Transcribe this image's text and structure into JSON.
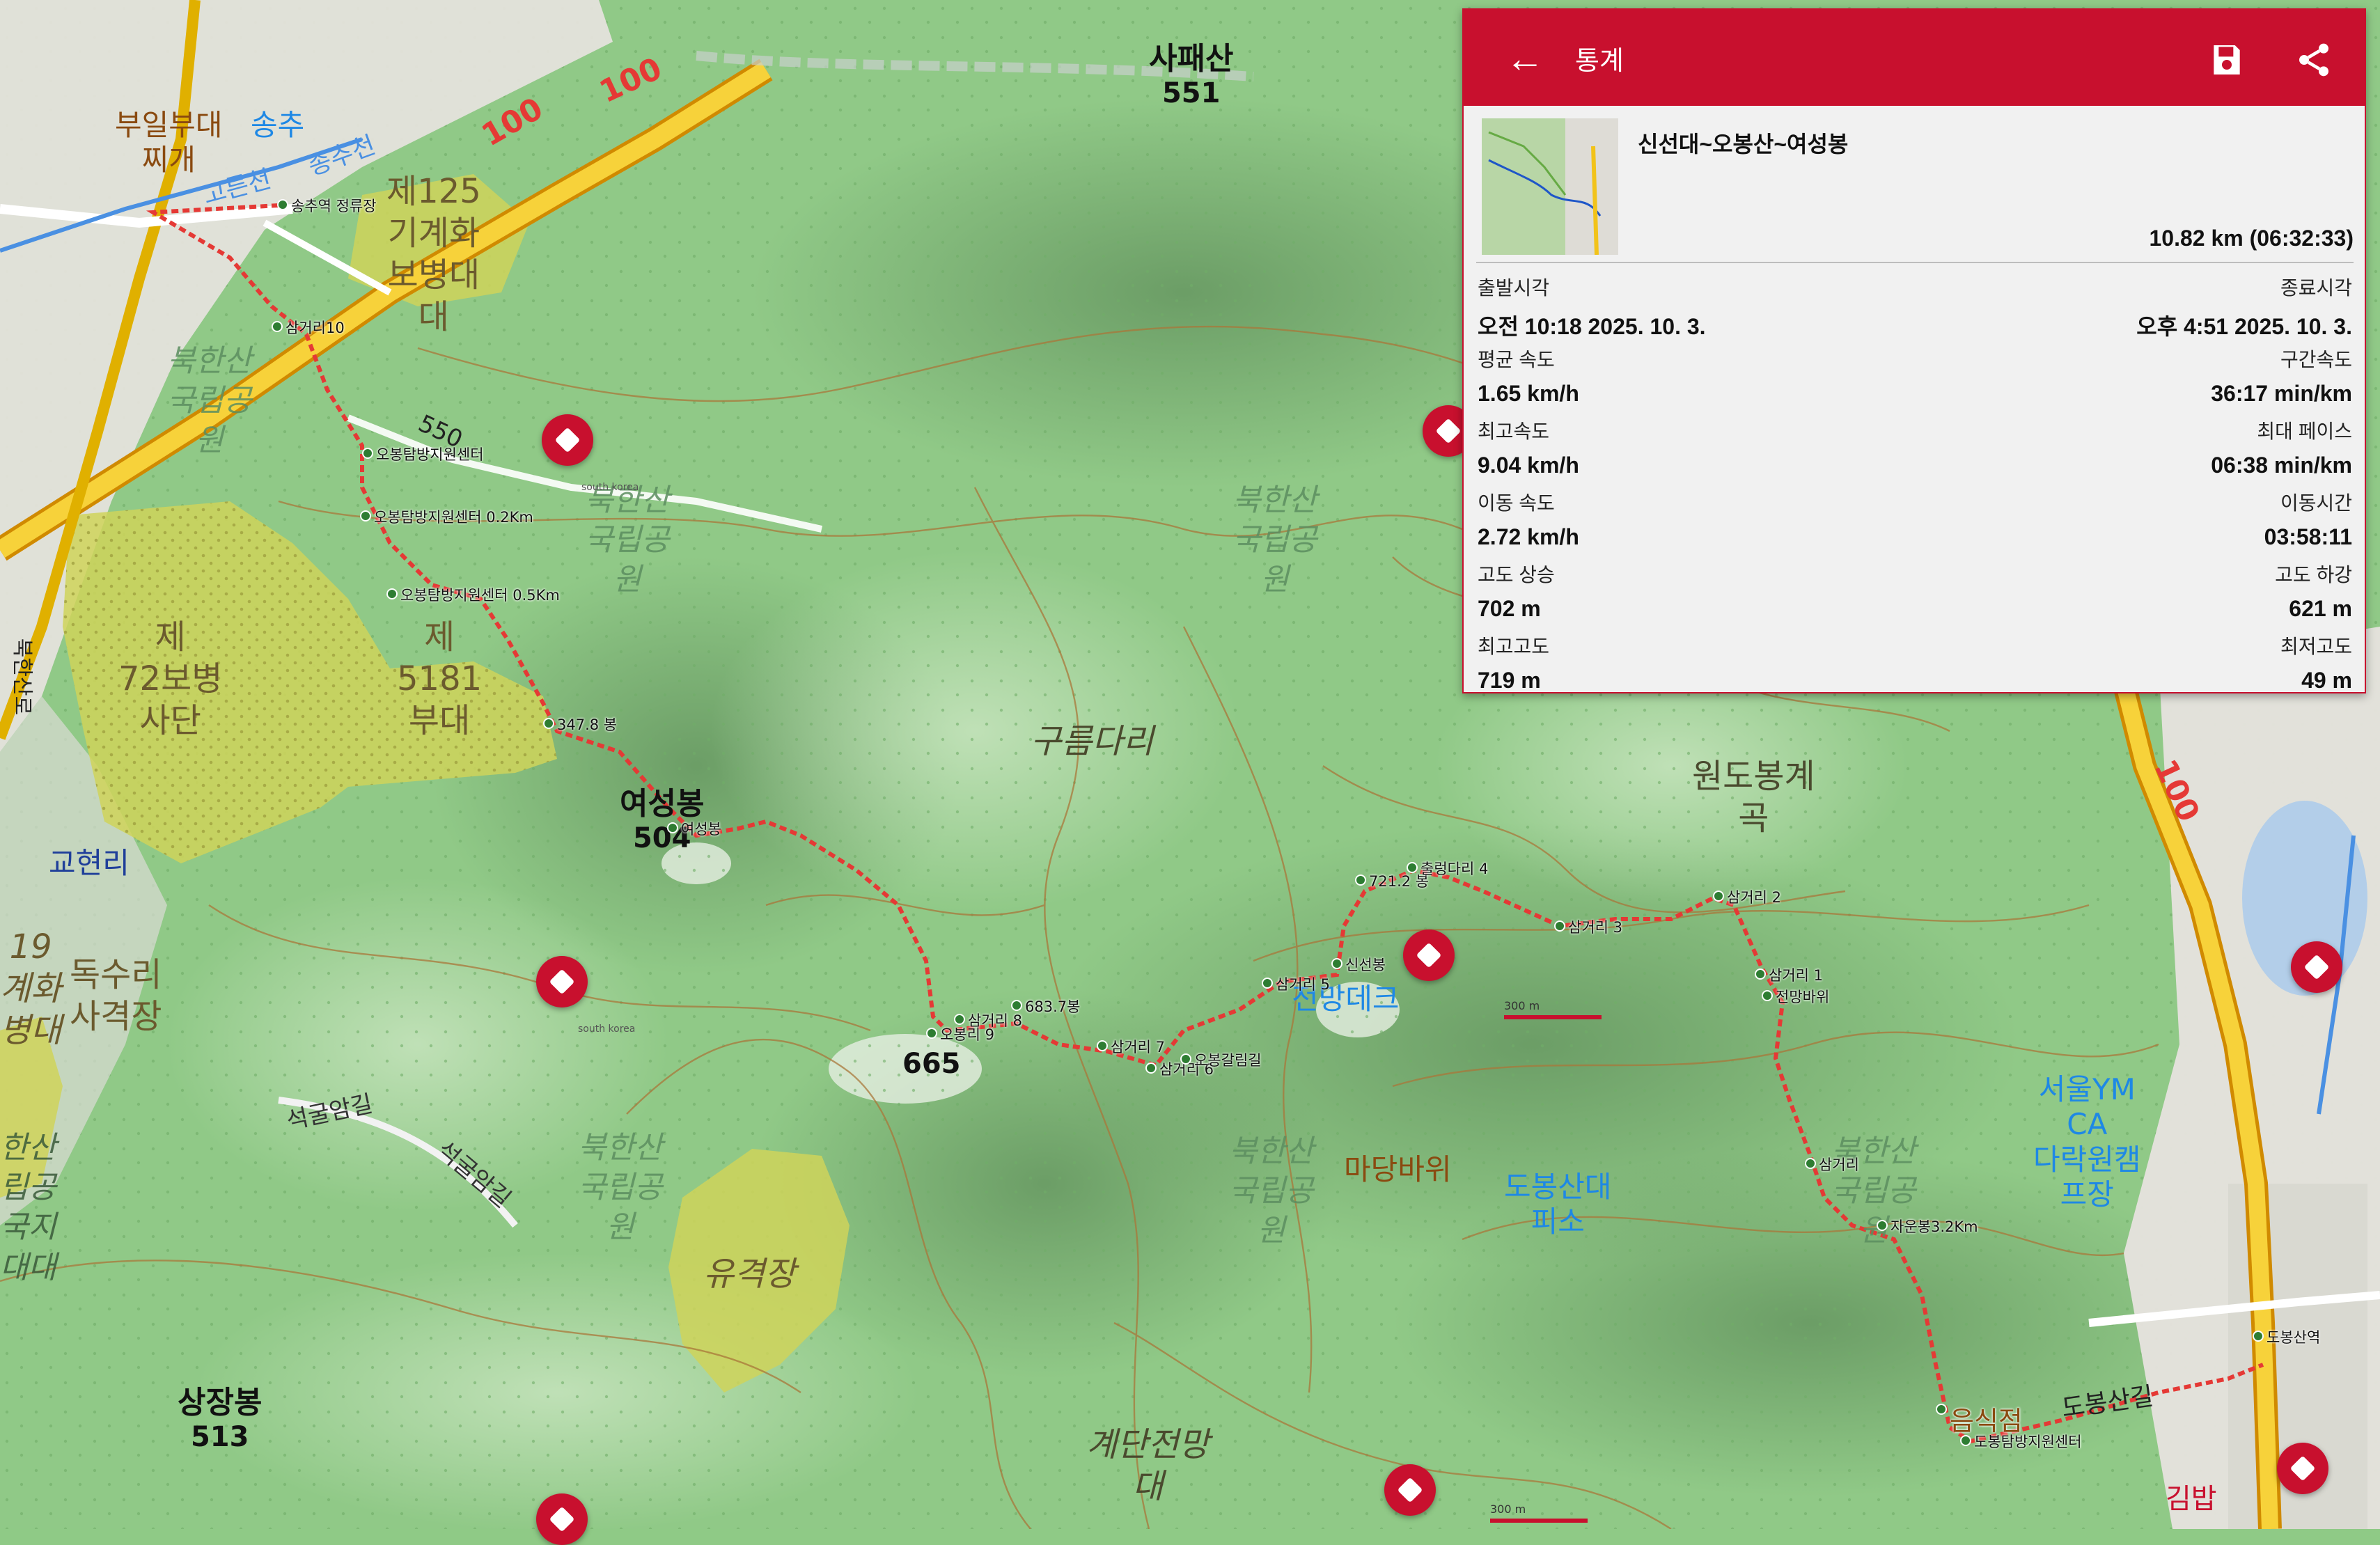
{
  "colors": {
    "header": "#c8102e",
    "route": "#e53935",
    "waypoint": "#2e7d32",
    "forest": "#8fca86",
    "military": "#cfd35a",
    "highway": "#f2c31a"
  },
  "stats_panel": {
    "title": "통계",
    "back_icon": "arrow-left-icon",
    "save_icon": "save-icon",
    "share_icon": "share-icon",
    "track_name": "신선대~오봉산~여성봉",
    "summary": "10.82 km (06:32:33)",
    "rows": [
      {
        "left_label": "출발시각",
        "left_value": "오전 10:18 2025. 10. 3.",
        "right_label": "종료시각",
        "right_value": "오후 4:51 2025. 10. 3."
      },
      {
        "left_label": "평균 속도",
        "left_value": "1.65 km/h",
        "right_label": "구간속도",
        "right_value": "36:17 min/km"
      },
      {
        "left_label": "최고속도",
        "left_value": "9.04 km/h",
        "right_label": "최대 페이스",
        "right_value": "06:38 min/km"
      },
      {
        "left_label": "이동 속도",
        "left_value": "2.72 km/h",
        "right_label": "이동시간",
        "right_value": "03:58:11"
      },
      {
        "left_label": "고도 상승",
        "left_value": "702 m",
        "right_label": "고도 하강",
        "right_value": "621 m"
      },
      {
        "left_label": "최고고도",
        "left_value": "719 m",
        "right_label": "최저고도",
        "right_value": "49 m"
      }
    ]
  },
  "map": {
    "peaks": [
      {
        "name": "사패산",
        "elev": "551"
      },
      {
        "name": "여성봉",
        "elev": "504"
      },
      {
        "name": "",
        "elev": "665"
      },
      {
        "name": "상장봉",
        "elev": "513"
      }
    ],
    "areas": {
      "bueil": "부일부대\n찌개",
      "unit125": "제125\n기계화\n보병대\n대",
      "unit72": "제\n72보병\n사단",
      "unit5181": "제\n5181\n부대",
      "gyohyeon": "교현리",
      "doksuri": "독수리\n사격장",
      "yugyeok": "유격장",
      "wondo": "원도봉계\n곡",
      "gyedan": "계단전망\n대",
      "gureum": "구름다리",
      "madang": "마당바위",
      "songchu": "송추",
      "jeonmang": "전망데크",
      "dobong_shelter": "도봉산대\n피소",
      "ymca": "서울YM\nCA\n다락원캠\n프장",
      "left19": "19\n계화\n병대",
      "left_park": "한산\n립공\n국지\n대대"
    },
    "park_label": "북한산\n국립공\n원",
    "road_labels": {
      "r100a": "100",
      "r100b": "100",
      "r100c": "100",
      "seokgul": "석굴암길",
      "seokgul2": "석굴암길",
      "dobongsan_gil": "도봉산길",
      "gimbap": "김밥",
      "r550": "550",
      "gojeongji": "고른천",
      "songchu_stream": "송추천",
      "bukhansan_ro": "북한산로"
    },
    "waypoints": [
      "송추역 정류장",
      "삼거리10",
      "오봉탐방지원센터",
      "오봉탐방지원센터 0.2Km",
      "오봉탐방지원센터 0.5Km",
      "347.8 봉",
      "여성봉",
      "오봉리 9",
      "삼거리 8",
      "683.7봉",
      "삼거리 7",
      "삼거리 6",
      "오봉갈림길",
      "삼거리 5",
      "신선봉",
      "721.2 봉",
      "출렁다리 4",
      "삼거리 3",
      "삼거리 2",
      "삼거리 1",
      "전망바위",
      "삼거리",
      "자운봉3.2Km",
      "음식점",
      "도봉탐방지원센터",
      "도봉산역"
    ],
    "scale_label": "300 m",
    "south_korea": "south korea",
    "marker_icon": "direction-diamond-icon"
  }
}
